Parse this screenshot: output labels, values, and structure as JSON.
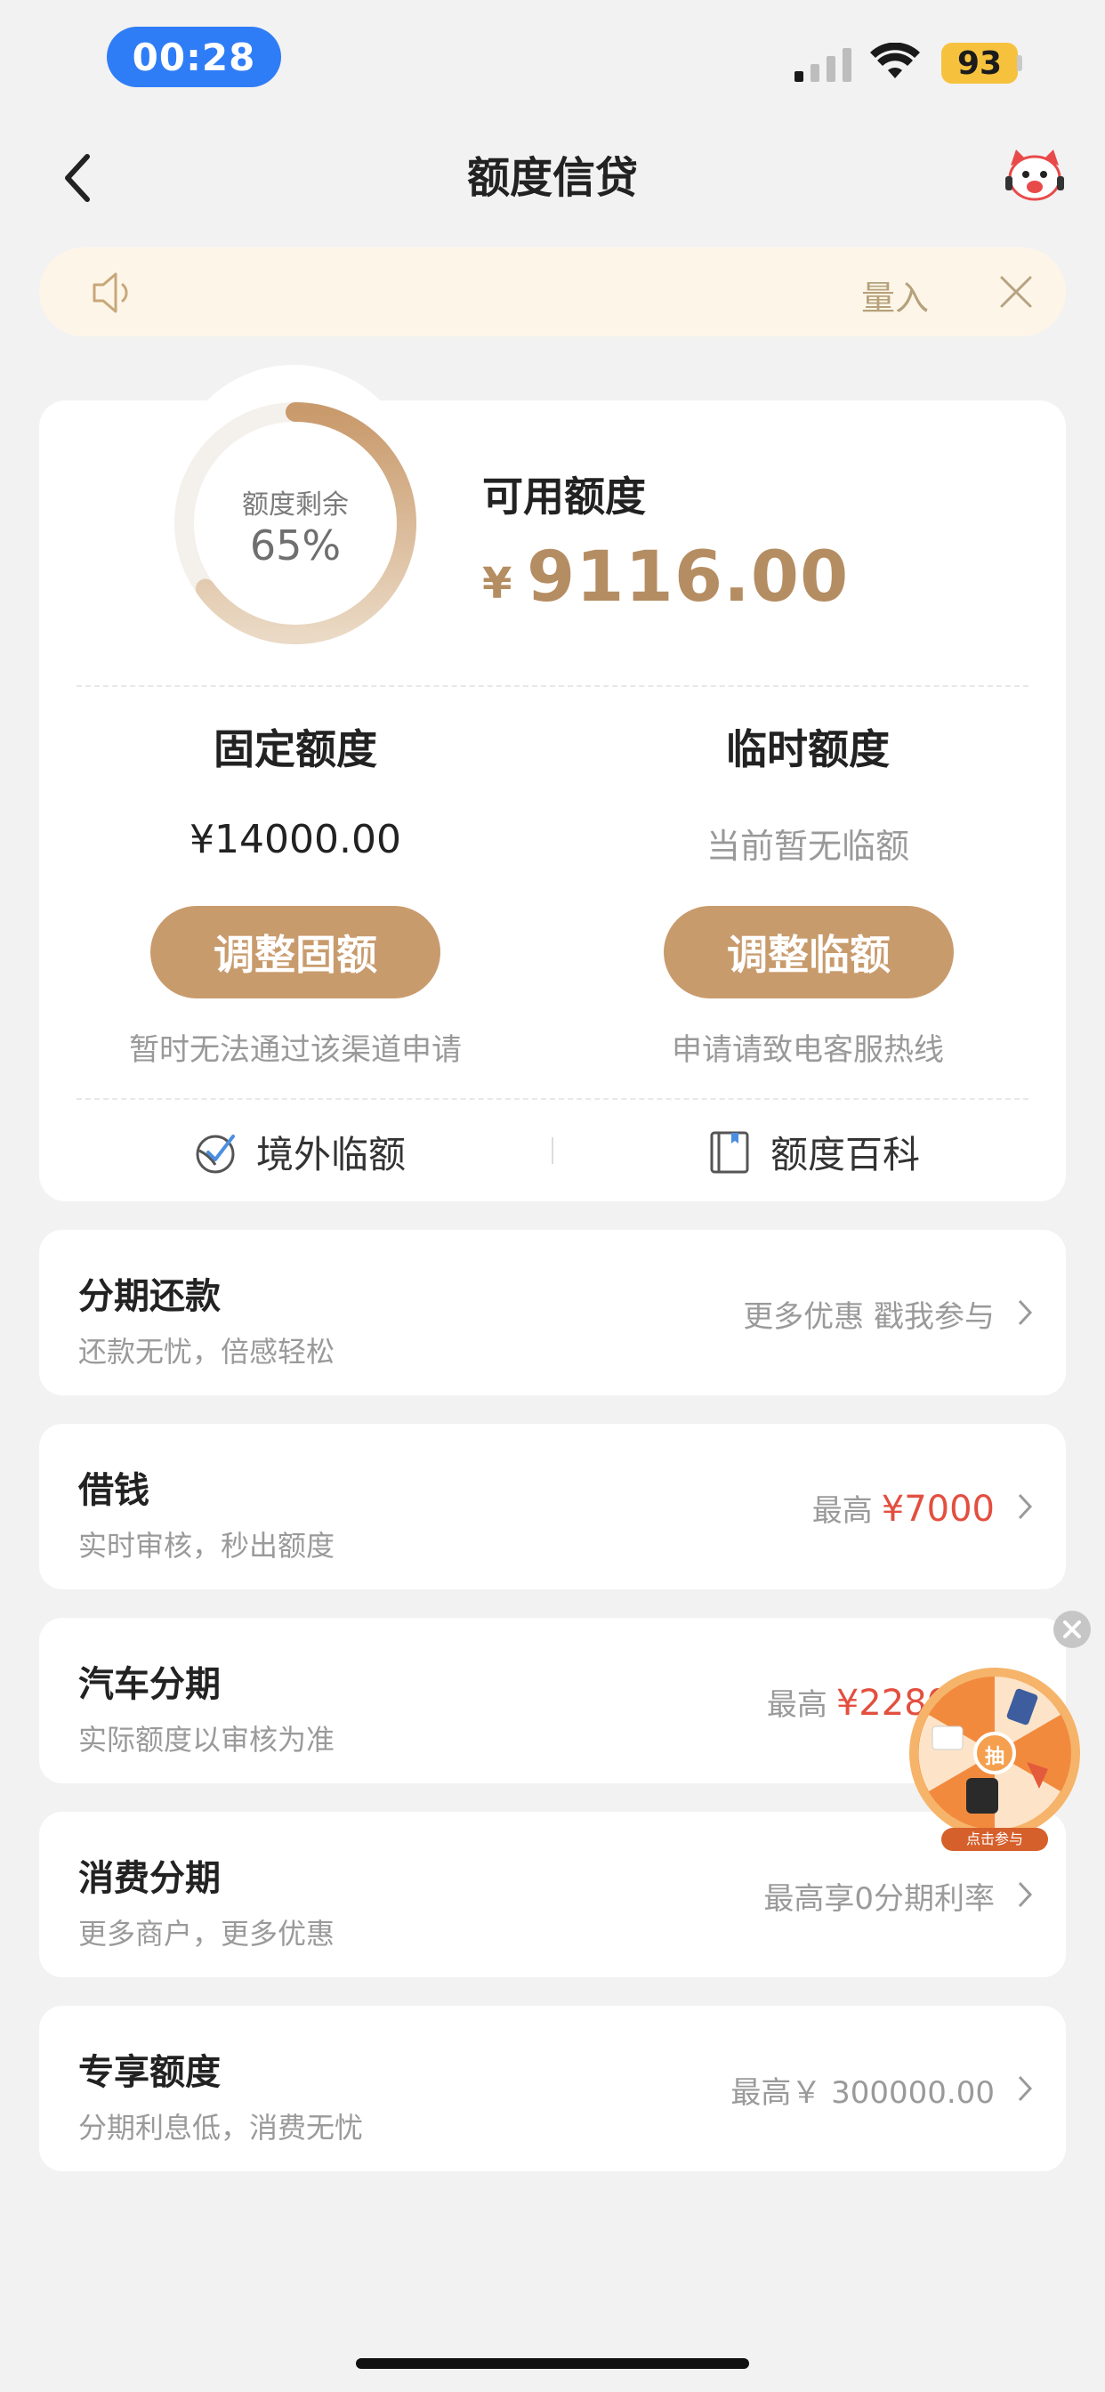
{
  "status_bar": {
    "time": "00:28",
    "battery": "93"
  },
  "nav": {
    "title": "额度信贷"
  },
  "notice": {
    "text": "量入"
  },
  "credit": {
    "ring_label": "额度剩余",
    "ring_percent": "65%",
    "ring_fraction": 0.65,
    "available_label": "可用额度",
    "currency": "¥",
    "available_amount": "9116.00",
    "fixed": {
      "title": "固定额度",
      "value": "¥14000.00",
      "button": "调整固额",
      "note": "暂时无法通过该渠道申请"
    },
    "temp": {
      "title": "临时额度",
      "value": "当前暂无临额",
      "button": "调整临额",
      "note": "申请请致电客服热线"
    },
    "links": {
      "overseas": "境外临额",
      "wiki": "额度百科"
    }
  },
  "list": [
    {
      "title": "分期还款",
      "subtitle": "还款无忧，倍感轻松",
      "right_prefix": "更多优惠 戳我参与",
      "right_amount": ""
    },
    {
      "title": "借钱",
      "subtitle": "实时审核，秒出额度",
      "right_prefix": "最高",
      "right_amount": "¥7000"
    },
    {
      "title": "汽车分期",
      "subtitle": "实际额度以审核为准",
      "right_prefix": "最高",
      "right_amount": "¥228000"
    },
    {
      "title": "消费分期",
      "subtitle": "更多商户，更多优惠",
      "right_prefix": "最高享0分期利率",
      "right_amount": ""
    },
    {
      "title": "专享额度",
      "subtitle": "分期利息低，消费无忧",
      "right_prefix": "最高￥ 300000.00",
      "right_amount": ""
    }
  ],
  "wheel": {
    "center": "抽",
    "caption": "点击参与"
  },
  "colors": {
    "accent": "#c89b6d",
    "amount": "#b58d62",
    "red": "#e34f3f",
    "time_pill": "#2f7df6"
  }
}
